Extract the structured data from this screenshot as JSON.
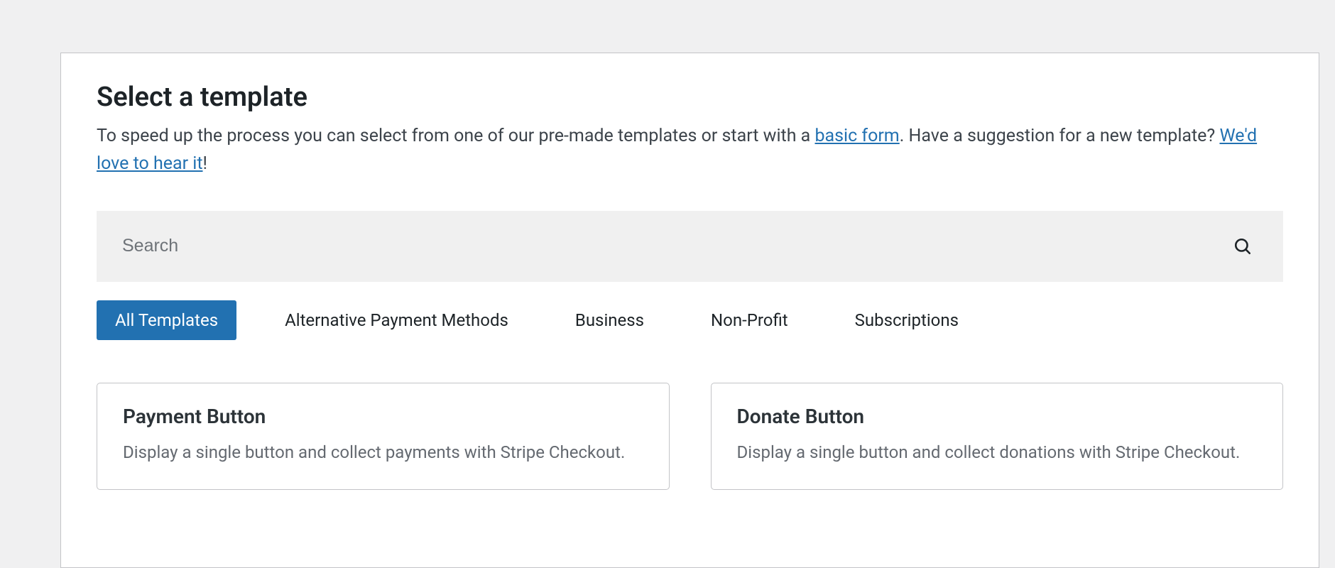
{
  "header": {
    "title": "Select a template",
    "desc_1": "To speed up the process you can select from one of our pre-made templates or start with a ",
    "link_basic_form": "basic form",
    "desc_2": ". Have a suggestion for a new template? ",
    "link_feedback": "We'd love to hear it",
    "desc_3": "!"
  },
  "search": {
    "placeholder": "Search",
    "value": ""
  },
  "tabs": [
    {
      "label": "All Templates",
      "active": true
    },
    {
      "label": "Alternative Payment Methods",
      "active": false
    },
    {
      "label": "Business",
      "active": false
    },
    {
      "label": "Non-Profit",
      "active": false
    },
    {
      "label": "Subscriptions",
      "active": false
    }
  ],
  "cards": [
    {
      "title": "Payment Button",
      "desc": "Display a single button and collect payments with Stripe Checkout."
    },
    {
      "title": "Donate Button",
      "desc": "Display a single button and collect donations with Stripe Checkout."
    }
  ]
}
